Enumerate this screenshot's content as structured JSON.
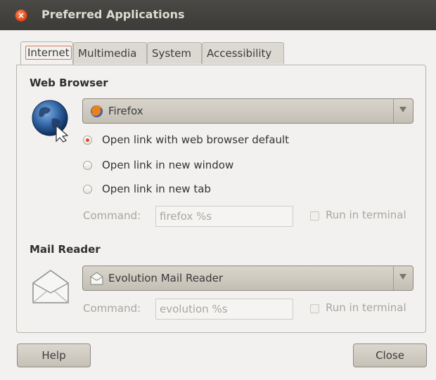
{
  "window": {
    "title": "Preferred Applications"
  },
  "tabs": [
    {
      "label": "Internet",
      "active": true
    },
    {
      "label": "Multimedia",
      "active": false
    },
    {
      "label": "System",
      "active": false
    },
    {
      "label": "Accessibility",
      "active": false
    }
  ],
  "web_browser": {
    "heading": "Web Browser",
    "selected": "Firefox",
    "selected_icon": "firefox-icon",
    "options": [
      {
        "label": "Open link with web browser default",
        "checked": true
      },
      {
        "label": "Open link in new window",
        "checked": false
      },
      {
        "label": "Open link in new tab",
        "checked": false
      }
    ],
    "command_label": "Command:",
    "command_value": "firefox %s",
    "run_in_terminal": "Run in terminal"
  },
  "mail_reader": {
    "heading": "Mail Reader",
    "selected": "Evolution Mail Reader",
    "selected_icon": "envelope-icon",
    "command_label": "Command:",
    "command_value": "evolution %s",
    "run_in_terminal": "Run in terminal"
  },
  "buttons": {
    "help": "Help",
    "close": "Close"
  },
  "colors": {
    "accent": "#df4a1a",
    "titlebar": "#3c3b37",
    "background": "#f2f1ef"
  }
}
